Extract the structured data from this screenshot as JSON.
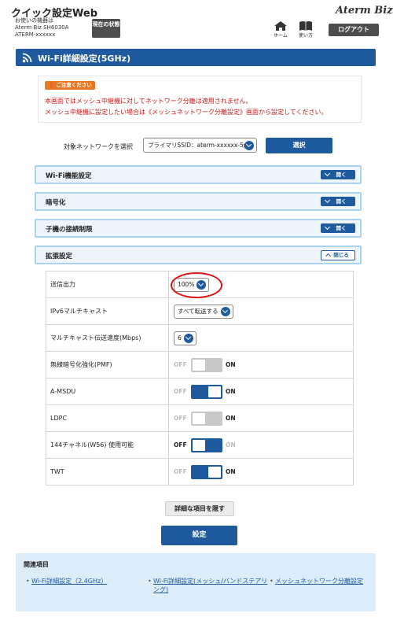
{
  "header": {
    "app_title": "クイック設定Web",
    "device_caption": "お使いの機器は",
    "device_model": "Aterm Biz SH6030A",
    "device_ssid": "ATERM-xxxxxx",
    "status_button": "現在の状態",
    "brand": "Aterm Biz",
    "home_label": "ホーム",
    "help_label": "使い方",
    "logout_button": "ログアウト"
  },
  "page": {
    "title": "Wi-Fi詳細設定(5GHz)"
  },
  "notice": {
    "badge": "ご注意ください",
    "line1": "本画面ではメッシュ中継機に対してネットワーク分離は適用されません。",
    "line2": "メッシュ中継機に設定したい場合は《メッシュネットワーク分離設定》画面から設定してください。"
  },
  "network": {
    "label": "対象ネットワークを選択",
    "selected": "プライマリSSID：aterm-xxxxxx-5p",
    "select_button": "選択"
  },
  "sections": [
    {
      "title": "Wi-Fi機能設定",
      "toggle": "開く"
    },
    {
      "title": "暗号化",
      "toggle": "開く"
    },
    {
      "title": "子機の接続制限",
      "toggle": "開く"
    },
    {
      "title": "拡張設定",
      "toggle": "閉じる"
    }
  ],
  "settings": {
    "tx_power": {
      "label": "送信出力",
      "value": "100%"
    },
    "ipv6_multicast": {
      "label": "IPv6マルチキャスト",
      "value": "すべて転送する"
    },
    "multicast_rate": {
      "label": "マルチキャスト伝送速度(Mbps)",
      "value": "6"
    },
    "pmf": {
      "label": "無線暗号化強化(PMF)",
      "state": "disabled"
    },
    "amsdu": {
      "label": "A-MSDU",
      "state": "on"
    },
    "ldpc": {
      "label": "LDPC",
      "state": "disabled"
    },
    "w56": {
      "label": "144チャネル(W56) 使用可能",
      "state": "off"
    },
    "twt": {
      "label": "TWT",
      "state": "on"
    },
    "off_text": "OFF",
    "on_text": "ON"
  },
  "actions": {
    "hide_details": "詳細な項目を隠す",
    "apply": "設定"
  },
  "related": {
    "title": "関連項目",
    "link1": "Wi-Fi詳細設定（2.4GHz）",
    "link2": "Wi-Fi詳細設定(メッシュ/バンドステアリング)",
    "link3": "メッシュネットワーク分離設定"
  },
  "colors": {
    "primary": "#1f5a9e",
    "section_bg": "#eef6fc",
    "section_border": "#a9d3ee",
    "warning_text": "#c41a1a",
    "notice_badge": "#e87722",
    "highlight": "#e01414"
  }
}
